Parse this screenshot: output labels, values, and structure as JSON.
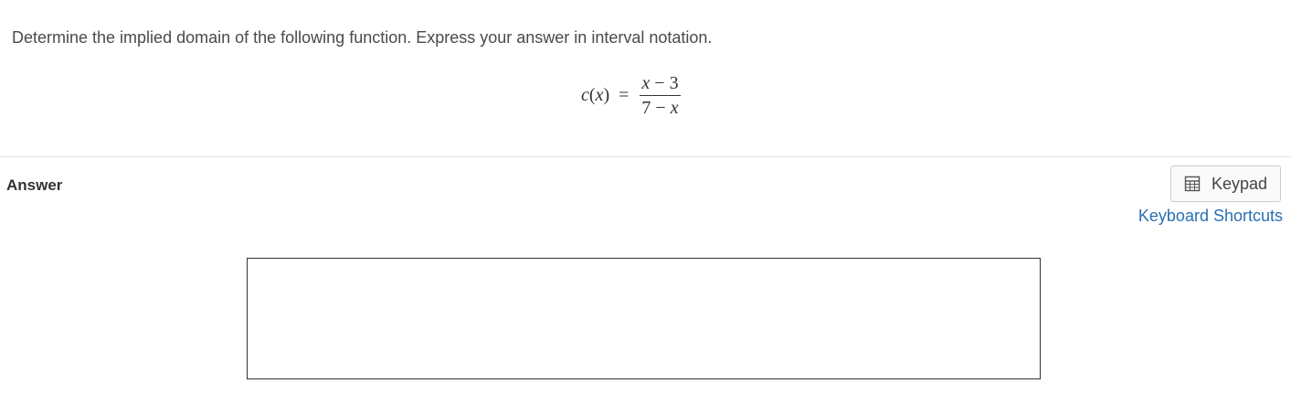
{
  "question": {
    "prompt": "Determine the implied domain of the following function. Express your answer in interval notation."
  },
  "equation": {
    "function_name": "c",
    "variable": "x",
    "equals": "=",
    "numerator": {
      "var": "x",
      "op": " − ",
      "const": "3"
    },
    "denominator": {
      "const": "7",
      "op": " − ",
      "var": "x"
    }
  },
  "answer": {
    "label": "Answer",
    "value": ""
  },
  "toolbar": {
    "keypad_label": "Keypad",
    "keypad_icon": "calculator-icon",
    "shortcuts_label": "Keyboard Shortcuts"
  },
  "colors": {
    "link": "#2a6fb3",
    "divider": "#e2e2e2"
  }
}
